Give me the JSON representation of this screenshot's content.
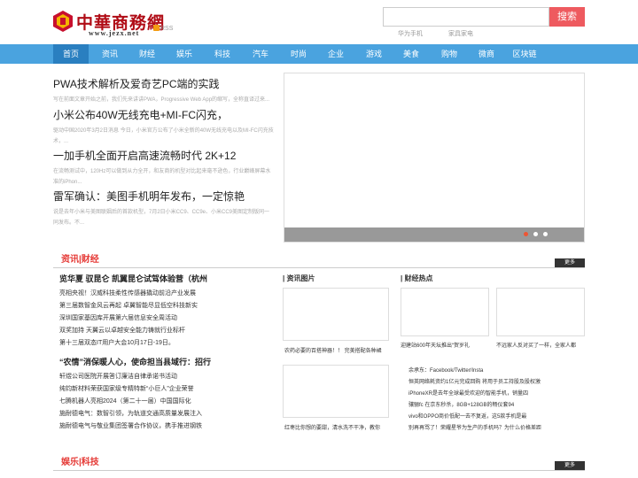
{
  "header": {
    "logo_text": "中華商務網",
    "logo_url": "www.jezx.net",
    "rss_label": "RSS",
    "search_placeholder": "",
    "search_button": "搜索",
    "hot_links": [
      "华为手机",
      "家具家电"
    ]
  },
  "nav": {
    "items": [
      "首页",
      "资讯",
      "财经",
      "娱乐",
      "科技",
      "汽车",
      "时尚",
      "企业",
      "游戏",
      "美食",
      "购物",
      "微商",
      "区块链"
    ],
    "active_index": 0
  },
  "top_articles": [
    {
      "title": "PWA技术解析及爱奇艺PC端的实践",
      "desc": "写在前面文章开始之前，我们先来讲讲PWA，Progressive Web App的缩写，全称直译过来..."
    },
    {
      "title": "小米公布40W无线充电+MI-FC闪充，",
      "desc": "驱动中国2020年3月2日消息 今日，小米官方公布了小米全新的40W无线充电以及MI-FC闪充技术，..."
    },
    {
      "title": "一加手机全面开启高速流畅时代 2K+12",
      "desc": "在流畅测试中，120Hz可以做到从力全开，和友商的机型对比起来毫不逊色，行业巅峰屏幕水准的iPhon..."
    },
    {
      "title": "雷军确认：美图手机明年发布，一定惊艳",
      "desc": "说是去年小米与美图联姻后的首款机型，7月2日小米CC9、CC9e、小米CC9美图定制版同一同发布。不..."
    }
  ],
  "slider": {
    "dot_count": 3,
    "active_dot": 0
  },
  "section1": {
    "title": "资讯|财经",
    "more": "更多",
    "group1_head": "览华夏 驭昆仑 凯翼昆仑试驾体验营（杭州",
    "group1_items": [
      "亮相央视！汉威科技柔性传感器撬动前沿产业发展",
      "第三届数智金风云再起 卓翼智能尽显低空科技新实",
      "深圳国家基因库开展第六届信息安全周活动",
      "双奖加持 天翼云以卓越安全能力铸就行业标杆",
      "第十三届双态IT用户大会10月17日-19日。"
    ],
    "group2_head": "“农情”消保暖人心，使命担当县域行：招行",
    "group2_items": [
      "轩煜公司医院开展答订廉洁自律承诺书活动",
      "纯钧新材料荣获国家级专精特新“小巨人”企业荣誉",
      "七腾机器人亮相2024（第二十一届）中国国际化",
      "施耐德电气：数智引领，为轨道交通高质量发展注入",
      "施耐德电气与敬业集团签署合作协议，携手推进钢铁"
    ],
    "col2_title": "| 资讯图片",
    "col2_captions": [
      "农药必要的百搭神器！！ 完美搭配各种裙",
      "红枣比你想的要甜，清水洗不干净，教你"
    ],
    "col3_title": "| 财经热点",
    "col3_captions": [
      "迎建站600年天坛推出“贺岁礼",
      "不远家人反对买了一样，全家人都"
    ],
    "col3_list": [
      "余承东：Facebook/Twitter/Insta",
      "恒英网络耗资约1亿元完成回购 将用于员工持股及股权激",
      "iPhoneXR是去年全球最受欢迎的智能手机，销量四",
      "骧骊fc 在京东秒杀，8GB+128GB的畅仪套94",
      "vivo和OPPO商价低配一去不复返，这5款手机是最",
      "别再再骂了！荣耀星爷为生产的手机吗？为什么价格差距"
    ]
  },
  "section2": {
    "title": "娱乐|科技",
    "more": "更多"
  }
}
